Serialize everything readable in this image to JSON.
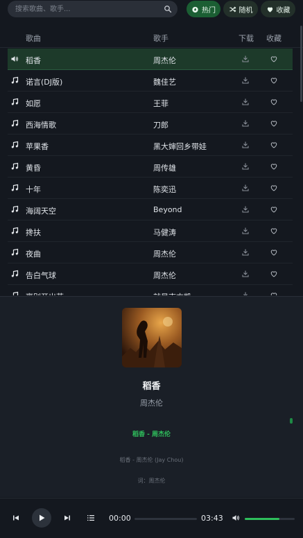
{
  "search": {
    "placeholder": "搜索歌曲、歌手..."
  },
  "tabs": {
    "hot": "热门",
    "random": "随机",
    "favorites": "收藏"
  },
  "columns": {
    "song": "歌曲",
    "artist": "歌手",
    "download": "下载",
    "favorite": "收藏"
  },
  "songs": [
    {
      "title": "稻香",
      "artist": "周杰伦",
      "playing": true
    },
    {
      "title": "诺言(DJ版)",
      "artist": "魏佳艺"
    },
    {
      "title": "如愿",
      "artist": "王菲"
    },
    {
      "title": "西海情歌",
      "artist": "刀郎"
    },
    {
      "title": "苹果香",
      "artist": "黑大婶回乡带娃"
    },
    {
      "title": "黄昏",
      "artist": "周传雄"
    },
    {
      "title": "十年",
      "artist": "陈奕迅"
    },
    {
      "title": "海阔天空",
      "artist": "Beyond"
    },
    {
      "title": "搀扶",
      "artist": "马健涛"
    },
    {
      "title": "夜曲",
      "artist": "周杰伦"
    },
    {
      "title": "告白气球",
      "artist": "周杰伦"
    },
    {
      "title": "离别开出花",
      "artist": "就是南方凯"
    }
  ],
  "now_playing": {
    "title": "稻香",
    "artist": "周杰伦",
    "lyric_current": "稻香 - 周杰伦",
    "lyric_line_1": "稻香 - 周杰伦 (Jay Chou)",
    "lyric_line_2": "词：周杰伦"
  },
  "playback": {
    "current_time": "00:00",
    "duration": "03:43",
    "progress_fraction": 0,
    "volume_fraction": 0.7
  },
  "colors": {
    "accent": "#2fbf5c",
    "active_row": "#1d3a2a",
    "background": "#14181f"
  }
}
